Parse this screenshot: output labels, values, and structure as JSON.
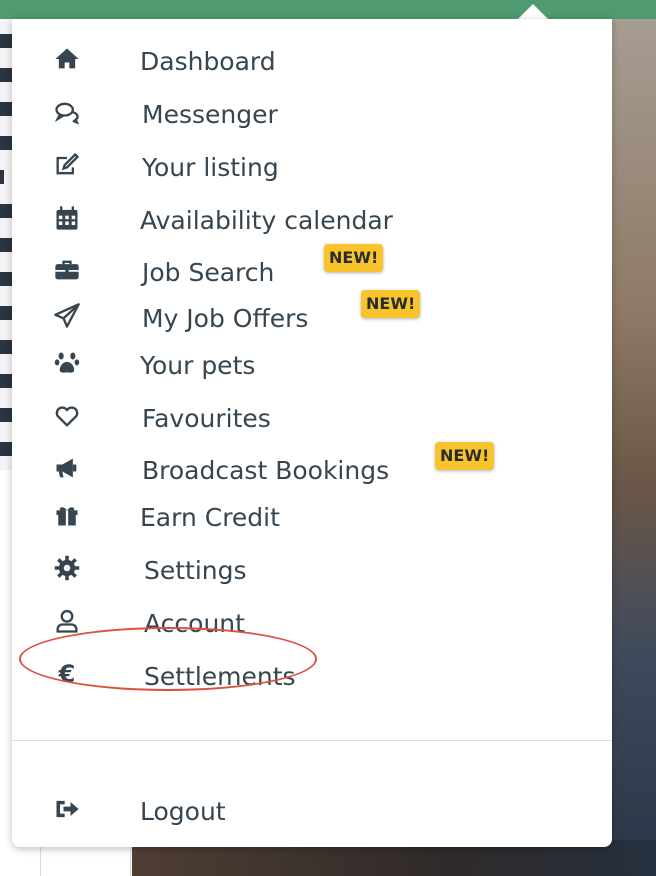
{
  "menu": {
    "items": [
      {
        "label": "Dashboard",
        "icon": "home-icon"
      },
      {
        "label": "Messenger",
        "icon": "chat-bubbles-icon"
      },
      {
        "label": "Your listing",
        "icon": "edit-icon"
      },
      {
        "label": "Availability calendar",
        "icon": "calendar-icon"
      },
      {
        "label": "Job Search",
        "icon": "briefcase-icon",
        "badge": "NEW!"
      },
      {
        "label": "My Job Offers",
        "icon": "paper-plane-icon",
        "badge": "NEW!"
      },
      {
        "label": "Your pets",
        "icon": "paw-icon"
      },
      {
        "label": "Favourites",
        "icon": "heart-icon"
      },
      {
        "label": "Broadcast Bookings",
        "icon": "megaphone-icon",
        "badge": "NEW!"
      },
      {
        "label": "Earn Credit",
        "icon": "gift-icon"
      },
      {
        "label": "Settings",
        "icon": "gear-icon"
      },
      {
        "label": "Account",
        "icon": "user-icon"
      },
      {
        "label": "Settlements",
        "icon": "euro-icon",
        "glyph": "€"
      }
    ],
    "logout": {
      "label": "Logout",
      "icon": "logout-icon"
    }
  },
  "colors": {
    "topbar": "#4f9a6e",
    "text": "#36454f",
    "badge": "#f7c52b",
    "annotation": "#d9533f"
  }
}
